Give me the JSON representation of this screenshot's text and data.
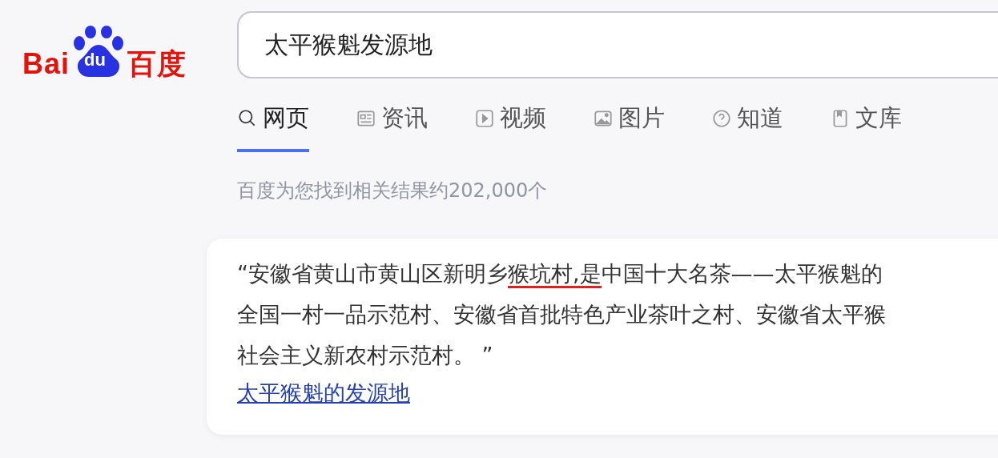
{
  "logo": {
    "left": "Bai",
    "paw": "du",
    "right": "百度"
  },
  "search": {
    "value": "太平猴魁发源地"
  },
  "tabs": [
    {
      "label": "网页",
      "kind": "search",
      "selected": true
    },
    {
      "label": "资讯",
      "kind": "news",
      "selected": false
    },
    {
      "label": "视频",
      "kind": "video",
      "selected": false
    },
    {
      "label": "图片",
      "kind": "image",
      "selected": false
    },
    {
      "label": "知道",
      "kind": "question",
      "selected": false
    },
    {
      "label": "文库",
      "kind": "doc",
      "selected": false
    }
  ],
  "result_count": "百度为您找到相关结果约202,000个",
  "answer": {
    "lines": [
      {
        "segments": [
          {
            "text": "“安徽省黄山市黄山区新明乡",
            "marked": false
          },
          {
            "text": "猴坑村,是",
            "marked": true
          },
          {
            "text": "中国十大名茶——太平猴魁的",
            "marked": false
          }
        ]
      },
      {
        "segments": [
          {
            "text": "全国一村一品示范村、安徽省首批特色产业茶叶之村、安徽省太平猴",
            "marked": false
          }
        ]
      },
      {
        "segments": [
          {
            "text": "社会主义新农村示范村。 ”",
            "marked": false
          }
        ]
      }
    ],
    "link": "太平猴魁的发源地"
  }
}
